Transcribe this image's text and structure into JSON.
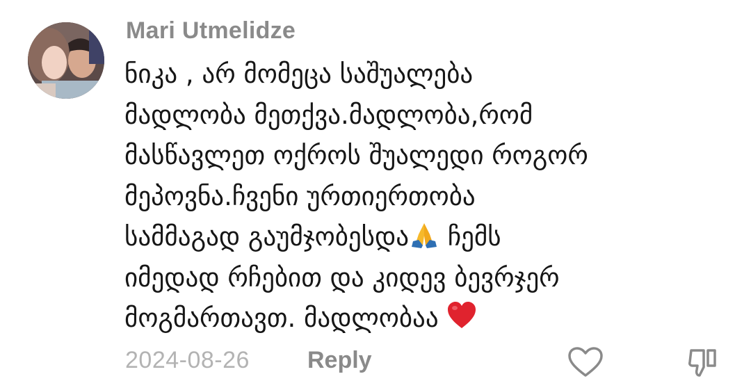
{
  "comment": {
    "author": "Mari Utmelidze",
    "avatar_icon": "user-avatar-photo",
    "lines": [
      "ნიკა , არ მომეცა საშუალება",
      "მადლობა მეთქვა.მადლობა,რომ",
      "მასწავლეთ ოქროს შუალედი როგორ",
      "მეპოვნა.ჩვენი ურთიერთობა",
      "სამმაგად გაუმჯობესდა",
      "ჩემს",
      "იმედად რჩებით და კიდევ ბევრჯერ",
      "მოგმართავთ. მადლობაა"
    ],
    "emojis": {
      "pray": "folded-hands-emoji",
      "heart": "red-heart-emoji"
    },
    "date": "2024-08-26",
    "reply_label": "Reply",
    "like_icon": "heart-outline-icon",
    "dislike_icon": "thumbs-down-icon",
    "colors": {
      "author": "#8a8a8a",
      "text": "#161616",
      "meta": "#b3b3b3",
      "heart": "#e0232e"
    }
  }
}
